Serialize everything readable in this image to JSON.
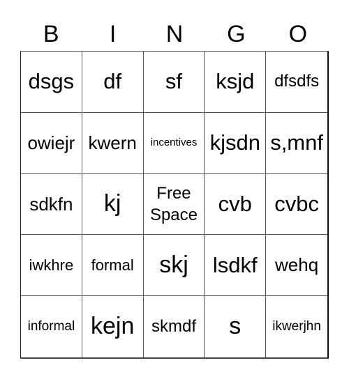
{
  "header": {
    "letters": [
      "B",
      "I",
      "N",
      "G",
      "O"
    ]
  },
  "board": {
    "rows": [
      [
        "dsgs",
        "df",
        "sf",
        "ksjd",
        "dfsdfs"
      ],
      [
        "owiejr",
        "kwern",
        "incentives",
        "kjsdn",
        "s,mnf"
      ],
      [
        "sdkfn",
        "kj",
        "Free Space",
        "cvb",
        "cvbc"
      ],
      [
        "iwkhre",
        "formal",
        "skj",
        "lsdkf",
        "wehq"
      ],
      [
        "informal",
        "kejn",
        "skmdf",
        "s",
        "ikwerjhn"
      ]
    ],
    "free_space": {
      "line1": "Free",
      "line2": "Space"
    }
  }
}
